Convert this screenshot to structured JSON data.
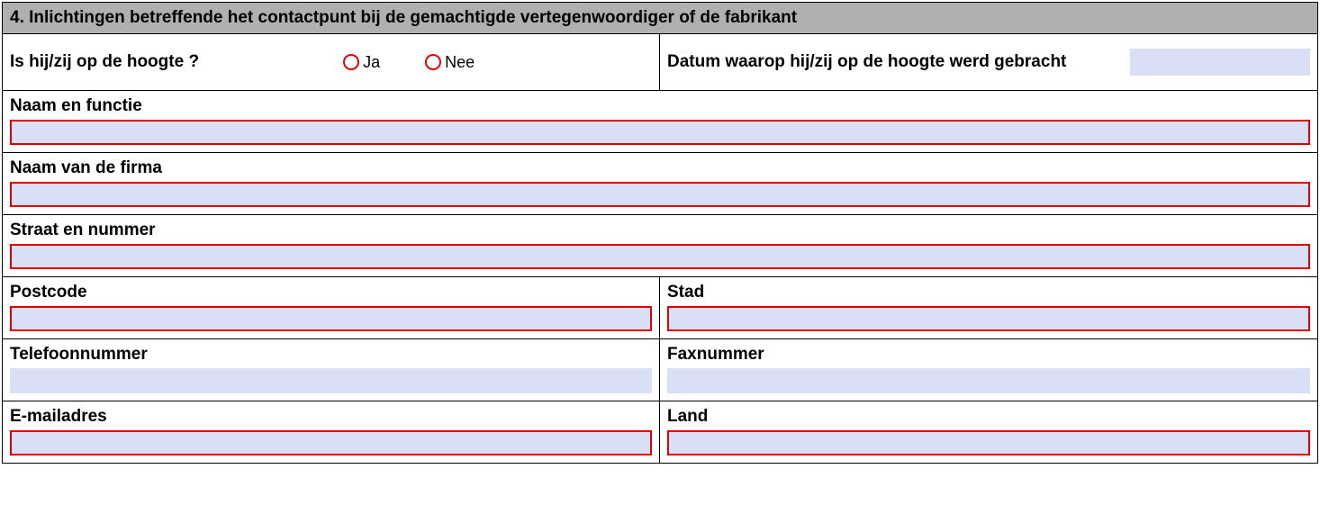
{
  "section": {
    "title": "4. Inlichtingen betreffende het contactpunt bij de gemachtigde vertegenwoordiger of de fabrikant"
  },
  "aware": {
    "question": "Is hij/zij op de hoogte ?",
    "yes": "Ja",
    "no": "Nee",
    "dateLabel": "Datum waarop hij/zij op de hoogte werd gebracht"
  },
  "fields": {
    "nameFunction": "Naam en functie",
    "companyName": "Naam van de firma",
    "street": "Straat en nummer",
    "postcode": "Postcode",
    "city": "Stad",
    "phone": "Telefoonnummer",
    "fax": "Faxnummer",
    "email": "E-mailadres",
    "country": "Land"
  }
}
